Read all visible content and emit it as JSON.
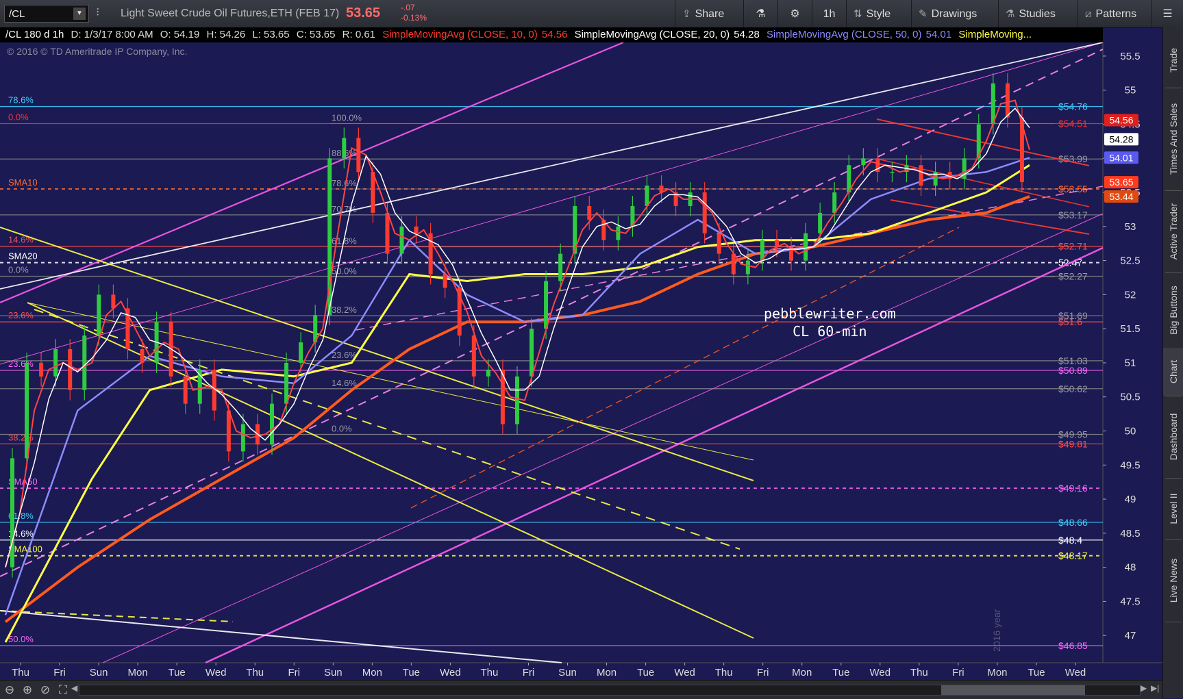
{
  "toolbar": {
    "symbol": "/CL",
    "description": "Light Sweet Crude Oil Futures,ETH (FEB 17)",
    "last_price": "53.65",
    "net_change": "-.07",
    "pct_change": "-0.13%",
    "share_label": "Share",
    "timeframe_label": "1h",
    "style_label": "Style",
    "drawings_label": "Drawings",
    "studies_label": "Studies",
    "patterns_label": "Patterns"
  },
  "infobar": {
    "symbol_period": "/CL 180 d 1h",
    "datetime": "D: 1/3/17 8:00 AM",
    "open": "O: 54.19",
    "high": "H: 54.26",
    "low": "L: 53.65",
    "close": "C: 53.65",
    "range": "R: 0.61",
    "sma10": "SimpleMovingAvg (CLOSE, 10, 0)",
    "sma10_value": "54.56",
    "sma20": "SimpleMovingAvg (CLOSE, 20, 0)",
    "sma20_value": "54.28",
    "sma50": "SimpleMovingAvg (CLOSE, 50, 0)",
    "sma50_value": "54.01",
    "sma100_trunc": "SimpleMoving..."
  },
  "copyright": "© 2016 © TD Ameritrade IP Company, Inc.",
  "watermark": {
    "line1": "pebblewriter.com",
    "line2": "CL 60-min"
  },
  "year_label": "2016 year",
  "sidebar": [
    "Trade",
    "Times And Sales",
    "Active Trader",
    "Big Buttons",
    "Chart",
    "Dashboard",
    "Level II",
    "Live News"
  ],
  "colors": {
    "sma10": "#ff4444",
    "sma20": "#ffffff",
    "sma50": "#8c8cff",
    "sma100": "#ffff44",
    "sma200": "#ff5a1f",
    "fib": "#ff66ff",
    "channel": "#ff5cf0",
    "up_candle": "#2ecc40",
    "down_candle": "#ff3b30",
    "background": "#1b1a52"
  },
  "chart_data": {
    "type": "candlestick",
    "title": "/CL 180 d 1h",
    "ylim": [
      46.6,
      55.7
    ],
    "y_ticks": [
      55.5,
      55,
      54.5,
      54,
      53.5,
      53,
      52.5,
      52,
      51.5,
      51,
      50.5,
      50,
      49.5,
      49,
      48.5,
      48,
      47.5,
      47
    ],
    "x_labels": [
      "Thu",
      "Fri",
      "Sun",
      "Mon",
      "Tue",
      "Wed",
      "Thu",
      "Fri",
      "Sun",
      "Mon",
      "Tue",
      "Wed",
      "Thu",
      "Fri",
      "Sun",
      "Mon",
      "Tue",
      "Wed",
      "Thu",
      "Fri",
      "Mon",
      "Tue",
      "Wed",
      "Thu",
      "Fri",
      "Mon",
      "Tue",
      "Wed"
    ],
    "price_bubbles": [
      {
        "value": "54.56",
        "color": "#e0201c"
      },
      {
        "value": "54.28",
        "color": "#ffffff"
      },
      {
        "value": "54.01",
        "color": "#5a5aee"
      },
      {
        "value": "53.65",
        "color": "#ff3b1f"
      },
      {
        "value": "53.44",
        "color": "#e04a10"
      }
    ],
    "levels": [
      {
        "price": 54.76,
        "label": "$54.76",
        "color": "#3fd0ff",
        "left_text": "78.6%"
      },
      {
        "price": 54.51,
        "label": "$54.51",
        "color": "#ff3030",
        "left_text": "0.0%"
      },
      {
        "price": 53.99,
        "label": "$53.99",
        "color": "#888888",
        "left_text": ""
      },
      {
        "price": 53.55,
        "label": "$53.55",
        "color": "#ff6a30",
        "left_text": "SMA10",
        "dashed": true
      },
      {
        "price": 53.17,
        "label": "$53.17",
        "color": "#888888",
        "left_text": ""
      },
      {
        "price": 52.71,
        "label": "$52.71",
        "color": "#ff5050",
        "left_text": "14.6%"
      },
      {
        "price": 52.47,
        "label": "52.47",
        "color": "#ffffff",
        "left_text": "SMA20",
        "dashed": true
      },
      {
        "price": 52.27,
        "label": "$52.27",
        "color": "#888888",
        "left_text": "0.0%"
      },
      {
        "price": 51.69,
        "label": "$51.69",
        "color": "#888888",
        "left_text": ""
      },
      {
        "price": 51.6,
        "label": "$51.6",
        "color": "#ff5050",
        "left_text": "23.6%"
      },
      {
        "price": 51.03,
        "label": "$51.03",
        "color": "#888888",
        "left_text": ""
      },
      {
        "price": 50.89,
        "label": "$50.89",
        "color": "#ff66ff",
        "left_text": "23.6%"
      },
      {
        "price": 50.62,
        "label": "$50.62",
        "color": "#888888",
        "left_text": ""
      },
      {
        "price": 49.95,
        "label": "$49.95",
        "color": "#888888",
        "left_text": ""
      },
      {
        "price": 49.81,
        "label": "$49.81",
        "color": "#ff5050",
        "left_text": "38.2%"
      },
      {
        "price": 49.16,
        "label": "$49.16",
        "color": "#ff66ff",
        "left_text": "SMA50",
        "dashed": true
      },
      {
        "price": 48.66,
        "label": "$48.66",
        "color": "#3fd0ff",
        "left_text": "61.8%"
      },
      {
        "price": 48.4,
        "label": "$48.4",
        "color": "#ffffff",
        "left_text": "14.6%"
      },
      {
        "price": 48.17,
        "label": "$48.17",
        "color": "#ffff44",
        "left_text": "SMA100",
        "dashed": true
      },
      {
        "price": 46.85,
        "label": "$46.85",
        "color": "#ff66ff",
        "left_text": "50.0%"
      }
    ],
    "fib_retracement_labels": [
      "100.0%",
      "88.6%",
      "78.6%",
      "70.7%",
      "61.8%",
      "50.0%",
      "38.2%",
      "23.6%",
      "14.6%",
      "0.0%"
    ],
    "fib_retracement_prices": [
      54.51,
      53.99,
      53.55,
      53.17,
      52.7,
      52.26,
      51.69,
      51.03,
      50.62,
      49.95
    ],
    "price_path": [
      [
        0,
        48.0
      ],
      [
        1,
        49.6
      ],
      [
        2,
        51.0
      ],
      [
        3,
        50.8
      ],
      [
        4,
        51.2
      ],
      [
        5,
        50.6
      ],
      [
        6,
        51.4
      ],
      [
        7,
        52.0
      ],
      [
        8,
        51.8
      ],
      [
        9,
        51.2
      ],
      [
        10,
        51.0
      ],
      [
        11,
        51.6
      ],
      [
        12,
        50.8
      ],
      [
        13,
        50.4
      ],
      [
        14,
        50.9
      ],
      [
        15,
        50.3
      ],
      [
        16,
        49.7
      ],
      [
        17,
        50.1
      ],
      [
        18,
        49.8
      ],
      [
        19,
        50.4
      ],
      [
        20,
        51.0
      ],
      [
        21,
        51.3
      ],
      [
        22,
        51.7
      ],
      [
        23,
        54.0
      ],
      [
        24,
        54.3
      ],
      [
        25,
        53.8
      ],
      [
        26,
        53.2
      ],
      [
        27,
        52.6
      ],
      [
        28,
        53.0
      ],
      [
        29,
        52.9
      ],
      [
        30,
        52.3
      ],
      [
        31,
        52.1
      ],
      [
        32,
        51.4
      ],
      [
        33,
        50.8
      ],
      [
        34,
        50.9
      ],
      [
        35,
        50.1
      ],
      [
        36,
        50.8
      ],
      [
        37,
        51.5
      ],
      [
        38,
        52.2
      ],
      [
        39,
        52.6
      ],
      [
        40,
        53.3
      ],
      [
        41,
        53.1
      ],
      [
        42,
        52.8
      ],
      [
        43,
        53.0
      ],
      [
        44,
        53.3
      ],
      [
        45,
        53.6
      ],
      [
        46,
        53.5
      ],
      [
        47,
        53.3
      ],
      [
        48,
        53.5
      ],
      [
        49,
        52.9
      ],
      [
        50,
        52.6
      ],
      [
        51,
        52.3
      ],
      [
        52,
        52.5
      ],
      [
        53,
        52.8
      ],
      [
        54,
        52.7
      ],
      [
        55,
        52.5
      ],
      [
        56,
        52.9
      ],
      [
        57,
        53.2
      ],
      [
        58,
        53.5
      ],
      [
        59,
        53.9
      ],
      [
        60,
        54.0
      ],
      [
        61,
        53.8
      ],
      [
        62,
        53.8
      ],
      [
        63,
        53.9
      ],
      [
        64,
        53.6
      ],
      [
        65,
        53.8
      ],
      [
        66,
        53.7
      ],
      [
        67,
        54.0
      ],
      [
        68,
        54.5
      ],
      [
        69,
        55.1
      ],
      [
        70,
        54.6
      ],
      [
        71,
        53.65
      ]
    ],
    "sma50_path": [
      [
        0,
        47.3
      ],
      [
        5,
        50.3
      ],
      [
        10,
        51.1
      ],
      [
        15,
        50.8
      ],
      [
        20,
        50.7
      ],
      [
        24,
        51.4
      ],
      [
        28,
        52.8
      ],
      [
        32,
        52.0
      ],
      [
        36,
        51.6
      ],
      [
        40,
        51.7
      ],
      [
        44,
        52.6
      ],
      [
        48,
        53.1
      ],
      [
        52,
        52.6
      ],
      [
        56,
        52.7
      ],
      [
        60,
        53.4
      ],
      [
        64,
        53.7
      ],
      [
        68,
        53.8
      ],
      [
        71,
        54.01
      ]
    ],
    "sma100_path": [
      [
        0,
        46.9
      ],
      [
        6,
        49.3
      ],
      [
        10,
        50.6
      ],
      [
        15,
        50.9
      ],
      [
        20,
        50.8
      ],
      [
        24,
        51.0
      ],
      [
        28,
        52.3
      ],
      [
        32,
        52.2
      ],
      [
        36,
        52.3
      ],
      [
        40,
        52.3
      ],
      [
        44,
        52.4
      ],
      [
        48,
        52.7
      ],
      [
        52,
        52.8
      ],
      [
        56,
        52.8
      ],
      [
        60,
        52.9
      ],
      [
        64,
        53.2
      ],
      [
        68,
        53.5
      ],
      [
        71,
        53.9
      ]
    ],
    "sma200_path": [
      [
        0,
        47.2
      ],
      [
        5,
        48.0
      ],
      [
        10,
        48.7
      ],
      [
        15,
        49.3
      ],
      [
        20,
        49.9
      ],
      [
        24,
        50.6
      ],
      [
        28,
        51.2
      ],
      [
        32,
        51.6
      ],
      [
        36,
        51.6
      ],
      [
        40,
        51.7
      ],
      [
        44,
        51.9
      ],
      [
        48,
        52.3
      ],
      [
        52,
        52.6
      ],
      [
        56,
        52.7
      ],
      [
        60,
        52.9
      ],
      [
        64,
        53.1
      ],
      [
        68,
        53.2
      ],
      [
        71,
        53.44
      ]
    ]
  }
}
